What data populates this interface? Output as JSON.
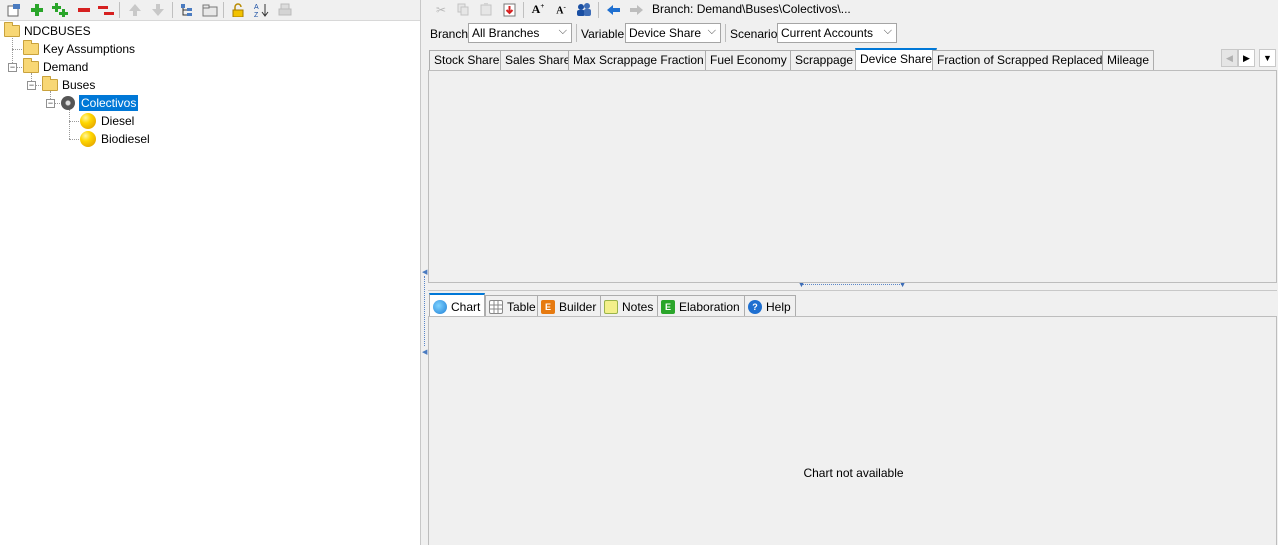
{
  "left_toolbar": {
    "icons": [
      "properties-icon",
      "add-branch-icon",
      "add-multiple-icon",
      "delete-icon",
      "delete-multiple-icon",
      "move-up-icon",
      "move-down-icon",
      "tree-view-icon",
      "folder-icon",
      "lock-icon",
      "sort-az-icon",
      "print-icon"
    ]
  },
  "tree": {
    "root": "NDCBUSES",
    "key_assumptions": "Key Assumptions",
    "demand": "Demand",
    "buses": "Buses",
    "colectivos": "Colectivos",
    "diesel": "Diesel",
    "biodiesel": "Biodiesel"
  },
  "right_toolbar": {
    "breadcrumb": "Branch: Demand\\Buses\\Colectivos\\..."
  },
  "selectors": {
    "branch_label": "Branch:",
    "branch_value": "All Branches",
    "variable_label": "Variable:",
    "variable_value": "Device Share",
    "scenario_label": "Scenario:",
    "scenario_value": "Current Accounts"
  },
  "variable_tabs": [
    {
      "label": "Stock Share"
    },
    {
      "label": "Sales Share"
    },
    {
      "label": "Max Scrappage Fraction"
    },
    {
      "label": "Fuel Economy"
    },
    {
      "label": "Scrappage"
    },
    {
      "label": "Device Share",
      "active": true
    },
    {
      "label": "Fraction of Scrapped Replaced"
    },
    {
      "label": "Mileage"
    }
  ],
  "bottom_tabs": [
    {
      "label": "Chart",
      "active": true
    },
    {
      "label": "Table"
    },
    {
      "label": "Builder"
    },
    {
      "label": "Notes"
    },
    {
      "label": "Elaboration"
    },
    {
      "label": "Help"
    }
  ],
  "chart_area": {
    "message": "Chart not available"
  },
  "colors": {
    "accent": "#0078d7",
    "folder": "#f8d775",
    "branch_ball": "#ffd700",
    "add_green": "#2aa52a",
    "delete_red": "#d62020"
  }
}
